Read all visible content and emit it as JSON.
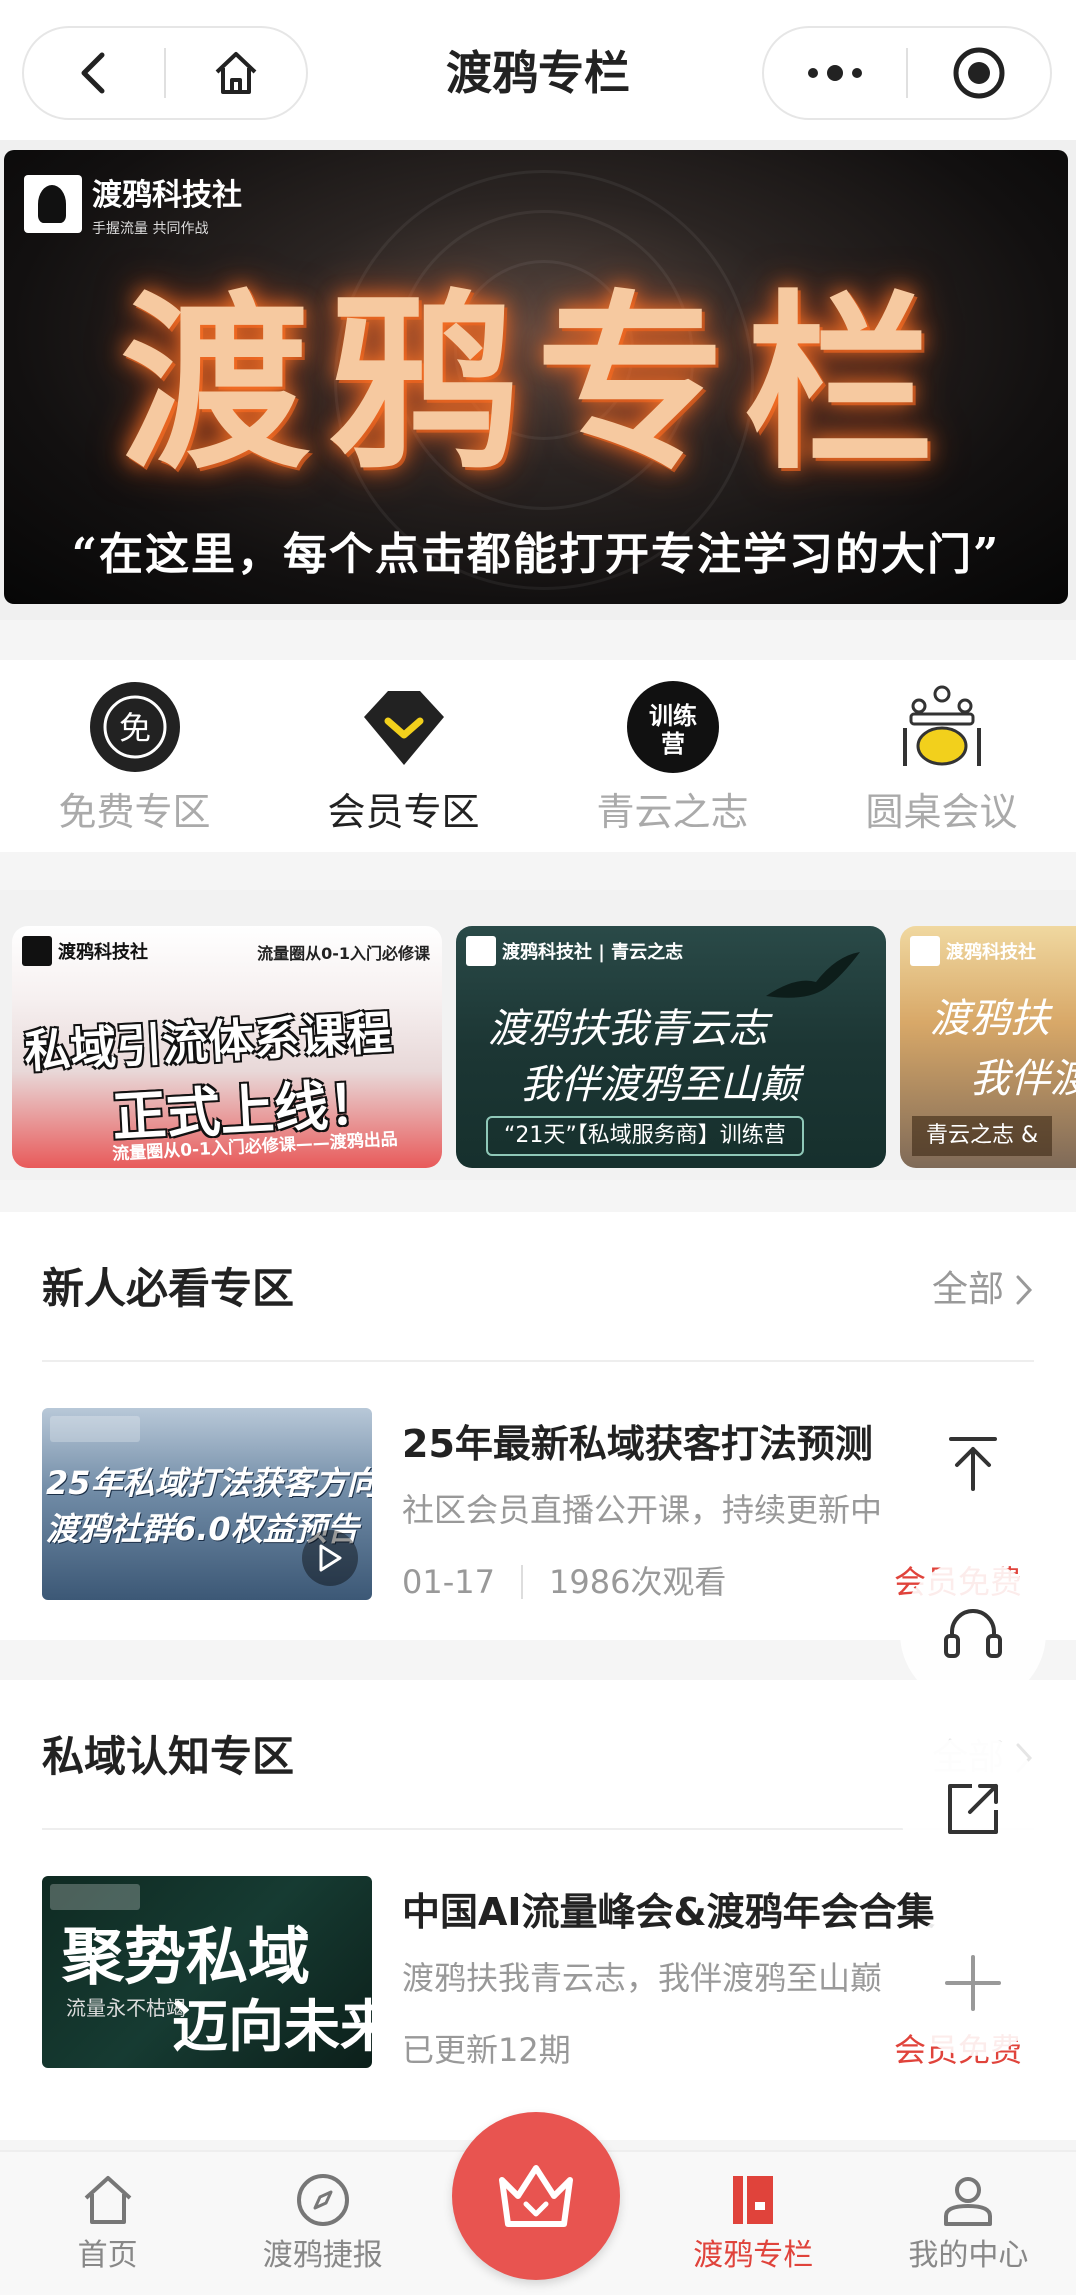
{
  "header": {
    "title": "渡鸦专栏",
    "back_icon": "chevron-left-icon",
    "home_icon": "home-icon",
    "more_icon": "more-dots-icon",
    "close_icon": "target-icon"
  },
  "banner": {
    "brand": "渡鸦科技社",
    "brand_slogan": "手握流量 共同作战",
    "headline": "渡鸦专栏",
    "tagline": "“在这里，每个点击都能打开专注学习的大门”"
  },
  "categories": [
    {
      "label": "免费专区",
      "icon": "free-icon",
      "icon_text": "免",
      "active": false
    },
    {
      "label": "会员专区",
      "icon": "vip-diamond-icon",
      "active": true
    },
    {
      "label": "青云之志",
      "icon": "training-camp-icon",
      "icon_text": "训练营",
      "active": false
    },
    {
      "label": "圆桌会议",
      "icon": "roundtable-icon",
      "active": false
    }
  ],
  "promos": [
    {
      "brand": "渡鸦科技社",
      "top_right": "流量圈从0-1入门必修课",
      "line1": "私域引流体系课程",
      "line2": "正式上线！",
      "footer": "流量圈从0-1入门必修课——渡鸦出品"
    },
    {
      "brand": "渡鸦科技社 | 青云之志",
      "line1": "渡鸦扶我青云志",
      "line2": "我伴渡鸦至山巅",
      "tag": "“21天”【私域服务商】训练营"
    },
    {
      "brand": "渡鸦科技社",
      "line1": "渡鸦扶",
      "line2": "我伴渡",
      "tag": "青云之志 &"
    }
  ],
  "sections": [
    {
      "title": "新人必看专区",
      "more_label": "全部",
      "item": {
        "thumb_line1": "25年私域打法获客方向",
        "thumb_line2": "渡鸦社群6.0权益预告",
        "title": "25年最新私域获客打法预测",
        "desc": "社区会员直播公开课，持续更新中",
        "date": "01-17",
        "views": "1986次观看",
        "badge": "会员免费"
      }
    },
    {
      "title": "私域认知专区",
      "more_label": "全部",
      "item": {
        "thumb_line1": "聚势私域",
        "thumb_line2": "流量永不枯竭",
        "thumb_line3": "迈向未来",
        "title": "中国AI流量峰会&渡鸦年会合集",
        "desc": "渡鸦扶我青云志，我伴渡鸦至山巅",
        "updated": "已更新12期",
        "badge": "会员免费"
      }
    }
  ],
  "float_buttons": [
    "back-to-top-icon",
    "headset-icon",
    "share-icon",
    "plus-icon"
  ],
  "tabbar": [
    {
      "label": "首页",
      "icon": "home-icon",
      "active": false
    },
    {
      "label": "渡鸦捷报",
      "icon": "compass-icon",
      "active": false
    },
    {
      "label": "",
      "icon": "crown-icon",
      "active": false
    },
    {
      "label": "渡鸦专栏",
      "icon": "column-book-icon",
      "active": true
    },
    {
      "label": "我的中心",
      "icon": "user-icon",
      "active": false
    }
  ],
  "colors": {
    "accent": "#e0433b",
    "center_button": "#e85450",
    "vip_yellow": "#f2d01c"
  }
}
